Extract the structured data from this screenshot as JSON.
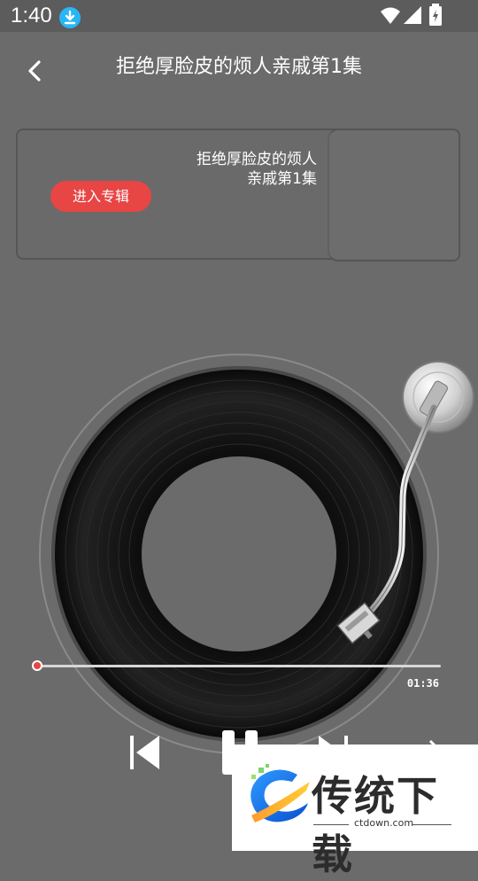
{
  "status_bar": {
    "time": "1:40"
  },
  "header": {
    "title": "拒绝厚脸皮的烦人亲戚第1集"
  },
  "album_card": {
    "title_line1": "拒绝厚脸皮的烦人",
    "title_line2": "亲戚第1集",
    "enter_button": "进入专辑"
  },
  "player": {
    "progress": 0.0,
    "duration": "01:36"
  },
  "watermark": {
    "brand": "传统下载",
    "url": "ctdown.com"
  },
  "colors": {
    "accent": "#e84545",
    "background": "#6b6b6b"
  }
}
